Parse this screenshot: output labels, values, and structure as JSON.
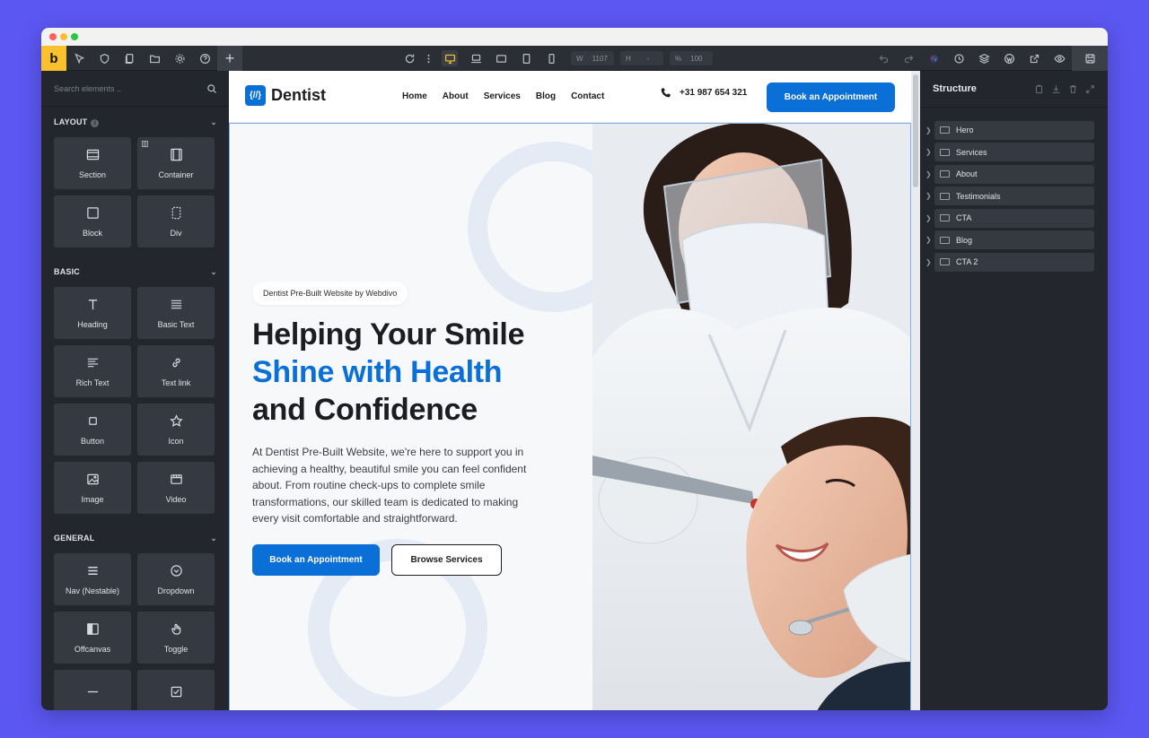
{
  "colors": {
    "frame_bg": "#5b57f2",
    "accent": "#fbc02d",
    "primary": "#0b6fd8",
    "panel": "#23272d"
  },
  "builder": {
    "logo": "b",
    "toolbar": {
      "width_label": "W",
      "width_value": "1107",
      "height_label": "H",
      "height_value": "-",
      "zoom_label": "%",
      "zoom_value": "100"
    },
    "left_panel": {
      "search_placeholder": "Search elements ..",
      "categories": [
        {
          "title": "LAYOUT",
          "items": [
            {
              "label": "Section",
              "icon": "section-icon"
            },
            {
              "label": "Container",
              "icon": "container-icon"
            },
            {
              "label": "Block",
              "icon": "block-icon"
            },
            {
              "label": "Div",
              "icon": "div-icon"
            }
          ]
        },
        {
          "title": "BASIC",
          "items": [
            {
              "label": "Heading",
              "icon": "heading-icon"
            },
            {
              "label": "Basic Text",
              "icon": "basic-text-icon"
            },
            {
              "label": "Rich Text",
              "icon": "rich-text-icon"
            },
            {
              "label": "Text link",
              "icon": "link-icon"
            },
            {
              "label": "Button",
              "icon": "button-icon"
            },
            {
              "label": "Icon",
              "icon": "star-icon"
            },
            {
              "label": "Image",
              "icon": "image-icon"
            },
            {
              "label": "Video",
              "icon": "video-icon"
            }
          ]
        },
        {
          "title": "GENERAL",
          "items": [
            {
              "label": "Nav (Nestable)",
              "icon": "nav-icon"
            },
            {
              "label": "Dropdown",
              "icon": "dropdown-icon"
            },
            {
              "label": "Offcanvas",
              "icon": "offcanvas-icon"
            },
            {
              "label": "Toggle",
              "icon": "toggle-icon"
            },
            {
              "label": "",
              "icon": "divider-icon"
            },
            {
              "label": "",
              "icon": "checkbox-icon"
            }
          ]
        }
      ]
    },
    "structure": {
      "title": "Structure",
      "items": [
        "Hero",
        "Services",
        "About",
        "Testimonials",
        "CTA",
        "Blog",
        "CTA 2"
      ]
    }
  },
  "site": {
    "brand_badge": "{//}",
    "brand_name": "Dentist",
    "nav": [
      "Home",
      "About",
      "Services",
      "Blog",
      "Contact"
    ],
    "phone": "+31 987 654 321",
    "nav_cta": "Book an Appointment",
    "hero": {
      "pill": "Dentist Pre-Built Website by Webdivo",
      "line1": "Helping Your Smile",
      "line2": "Shine with Health",
      "line3": "and Confidence",
      "paragraph": "At Dentist Pre-Built Website, we're here to support you in achieving a healthy, beautiful smile you can feel confident about. From routine check-ups to complete smile transformations, our skilled team is dedicated to making every visit comfortable and straightforward.",
      "primary_button": "Book an Appointment",
      "secondary_button": "Browse Services"
    }
  }
}
